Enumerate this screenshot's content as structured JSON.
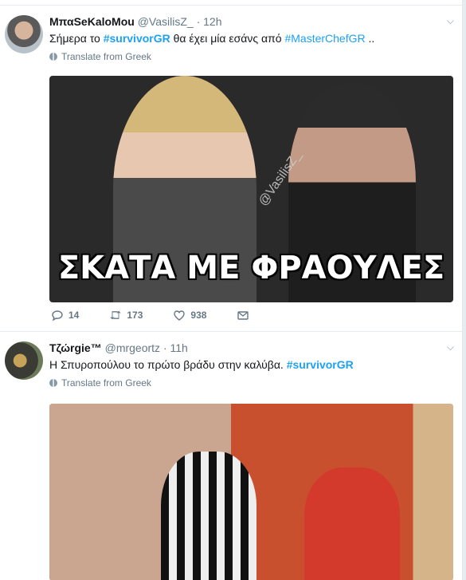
{
  "tweets": [
    {
      "name": "ΜπαSeKaloMou",
      "handle": "@VasilisZ_",
      "dot": "·",
      "time": "12h",
      "text_before": "Σήμερα το ",
      "hashtag1": "#survivorGR",
      "text_middle": " θα έχει μία εσάνς από ",
      "mention": "#MasterChefGR",
      "text_after": " ..",
      "translate": "Translate from Greek",
      "media_caption": "ΣΚΑΤΑ ΜΕ ΦΡΑΟΥΛΕΣ",
      "media_watermark": "@VasilisZ_",
      "actions": {
        "reply_count": "14",
        "retweet_count": "173",
        "like_count": "938"
      }
    },
    {
      "name": "Τζώrgie™",
      "handle": "@mrgeortz",
      "dot": "·",
      "time": "11h",
      "text_before": "Η Σπυροπούλου το πρώτο βράδυ στην καλύβα. ",
      "hashtag1": "#survivorGR",
      "translate": "Translate from Greek"
    }
  ],
  "icons": {
    "reply": "reply-icon",
    "retweet": "retweet-icon",
    "like": "heart-icon",
    "dm": "envelope-icon",
    "caret": "chevron-down-icon",
    "globe": "globe-icon"
  },
  "colors": {
    "link": "#1da1f2",
    "muted": "#657786",
    "text": "#14171a"
  }
}
